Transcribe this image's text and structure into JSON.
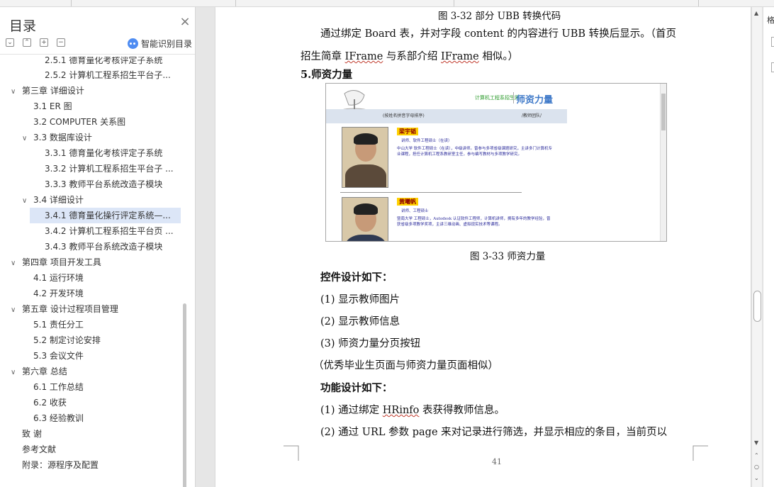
{
  "toc": {
    "title": "目录",
    "ai_label": "智能识别目录",
    "items": [
      {
        "label": "2.5.1 德育量化考核评定子系统"
      },
      {
        "label": "2.5.2 计算机工程系招生平台子..."
      },
      {
        "label": "第三章  详细设计"
      },
      {
        "label": "3.1 ER 图"
      },
      {
        "label": "3.2 COMPUTER 关系图"
      },
      {
        "label": "3.3  数据库设计"
      },
      {
        "label": "3.3.1  德育量化考核评定子系统"
      },
      {
        "label": "3.3.2  计算机工程系招生平台子 ..."
      },
      {
        "label": "3.3.3  教师平台系统改造子模块"
      },
      {
        "label": "3.4  详细设计"
      },
      {
        "label": "3.4.1 德育量化操行评定系统—..."
      },
      {
        "label": "3.4.2 计算机工程系招生平台页 ..."
      },
      {
        "label": "3.4.3 教师平台系统改造子模块"
      },
      {
        "label": "第四章  项目开发工具"
      },
      {
        "label": "4.1    运行环境"
      },
      {
        "label": "4.2    开发环境"
      },
      {
        "label": "第五章  设计过程项目管理"
      },
      {
        "label": "5.1  责任分工"
      },
      {
        "label": "5.2  制定讨论安排"
      },
      {
        "label": "5.3  会议文件"
      },
      {
        "label": "第六章  总结"
      },
      {
        "label": "6.1  工作总结"
      },
      {
        "label": "6.2  收获"
      },
      {
        "label": "6.3  经验教训"
      },
      {
        "label": "致    谢"
      },
      {
        "label": "参考文献"
      },
      {
        "label": "附录：源程序及配置"
      }
    ]
  },
  "doc": {
    "caption_332": "图 3-32 部分 UBB 转换代码",
    "para1_line1": "通过绑定 Board 表，并对字段 content 的内容进行 UBB 转换后显示。（首页",
    "para1_line2_a": "招生简章 ",
    "para1_line2_b": "IFrame",
    "para1_line2_c": " 与系部介绍 ",
    "para1_line2_d": "IFrame",
    "para1_line2_e": " 相似。）",
    "section_heading": "5.师资力量",
    "figure": {
      "site_logo": "计算机工程系招生网",
      "heading": "师资力量",
      "nav_left": "(按姓名拼音字母排序)",
      "nav_right": "/教师团队/",
      "teacher1_name": "梁宇韬",
      "teacher1_title": "讲师、软件工程硕士（在读）",
      "teacher1_bio": "中山大学 软件工程硕士（在读），中级讲师。曾参与多项省级课题研究，主讲多门计算机专业课程，担任计算机工程系教研室主任，参与编写教材与多项教学研究。",
      "teacher2_name": "黄曦帆",
      "teacher2_title": "讲师、工程硕士",
      "teacher2_bio": "暨南大学 工程硕士，Autodesk 认证软件工程师，计算机讲师，拥有多年的教学经验，曾获省级多项教学奖项，主讲三维动画、虚拟现实技术等课程。"
    },
    "caption_333": "图 3-33 师资力量",
    "controls_heading": "控件设计如下：",
    "control_items": [
      "(1)  显示教师图片",
      "(2)  显示教师信息",
      "(3)  师资力量分页按钮"
    ],
    "note": "（优秀毕业生页面与师资力量页面相似）",
    "func_heading": "功能设计如下：",
    "func1_a": "(1)  通过绑定 ",
    "func1_b": "HRinfo",
    "func1_c": " 表获得教师信息。",
    "func2": "(2)  通过 URL 参数 page 来对记录进行筛选，并显示相应的条目，当前页以",
    "page_number": "41"
  },
  "right_panel": {
    "glyph": "格"
  }
}
